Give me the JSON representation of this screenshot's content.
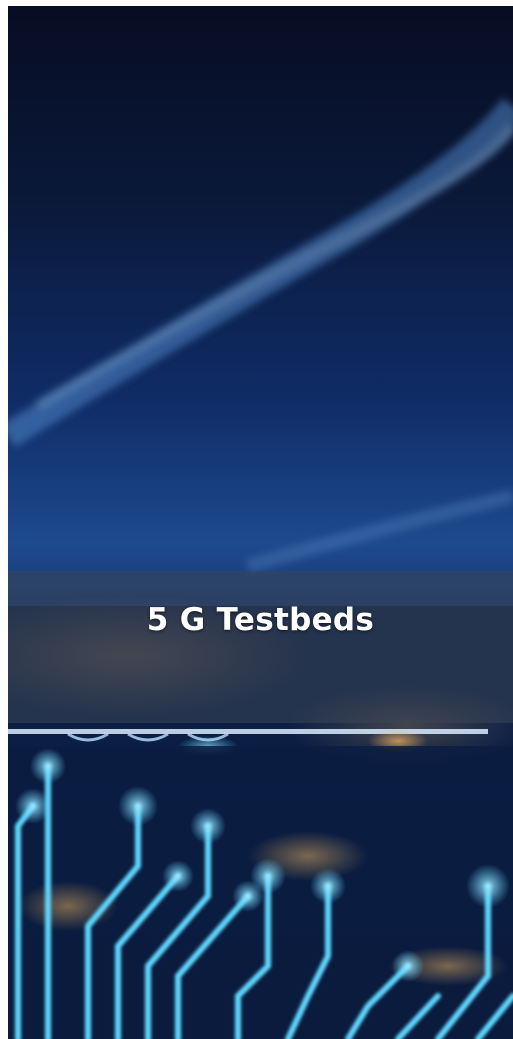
{
  "card": {
    "title": "5 G Testbeds"
  },
  "colors": {
    "sky_top": "#070d23",
    "sky_mid": "#0f2c66",
    "sky_low": "#1d4a8e",
    "city_dark": "#071634",
    "circuit_glow": "#5fd8ff",
    "city_light": "#f4b860",
    "caption_band": "#3c4655"
  }
}
